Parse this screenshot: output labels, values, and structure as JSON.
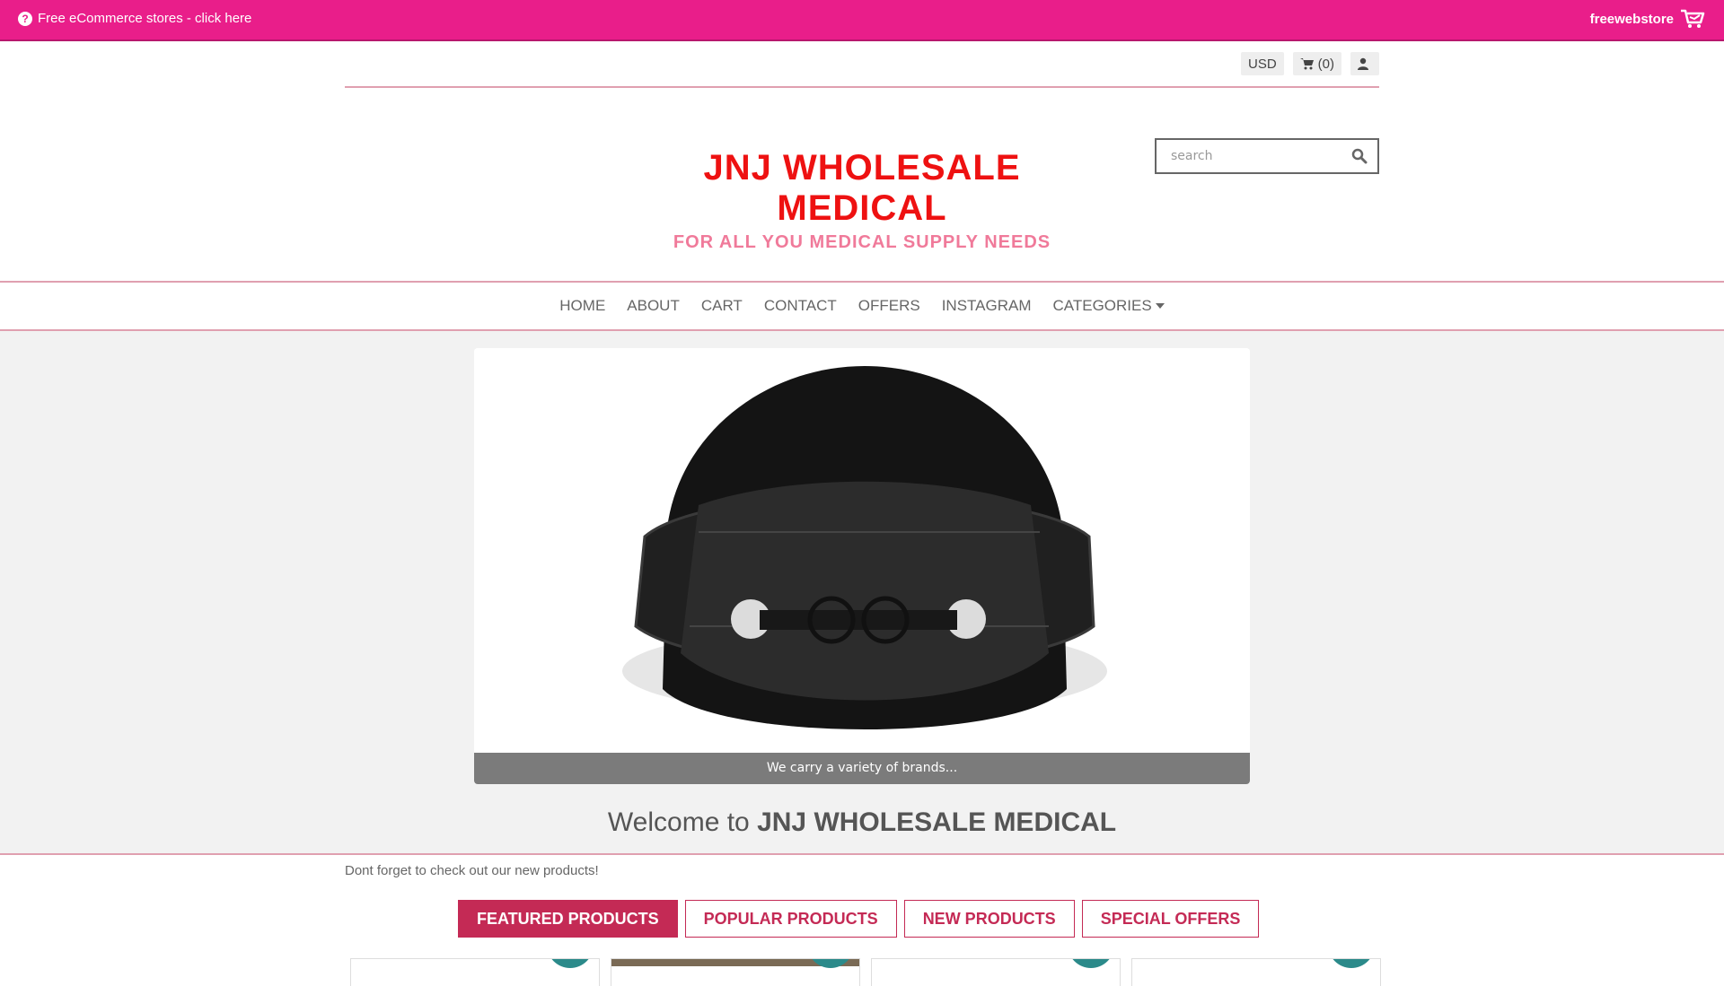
{
  "promo": {
    "left_text": "Free eCommerce stores - click here",
    "right_brand": "freewebstore",
    "background": "#e91e8a"
  },
  "utility": {
    "currency": "USD",
    "cart_label": "(0)"
  },
  "logo": {
    "title": "JNJ WHOLESALE MEDICAL",
    "subtitle": "FOR ALL YOU MEDICAL SUPPLY NEEDS"
  },
  "search": {
    "placeholder": "search"
  },
  "nav": {
    "items": [
      "HOME",
      "ABOUT",
      "CART",
      "CONTACT",
      "OFFERS",
      "INSTAGRAM",
      "CATEGORIES"
    ]
  },
  "slider": {
    "caption": "We carry a variety of brands..."
  },
  "welcome": {
    "prefix": "Welcome to",
    "store_name": "JNJ WHOLESALE MEDICAL"
  },
  "note": "Dont forget to check out our new products!",
  "tabs": [
    "FEATURED PRODUCTS",
    "POPULAR PRODUCTS",
    "NEW PRODUCTS",
    "SPECIAL OFFERS"
  ],
  "colors": {
    "accent": "#c42a55",
    "logo_red": "#ee1111",
    "logo_pink": "#f07a9a"
  }
}
